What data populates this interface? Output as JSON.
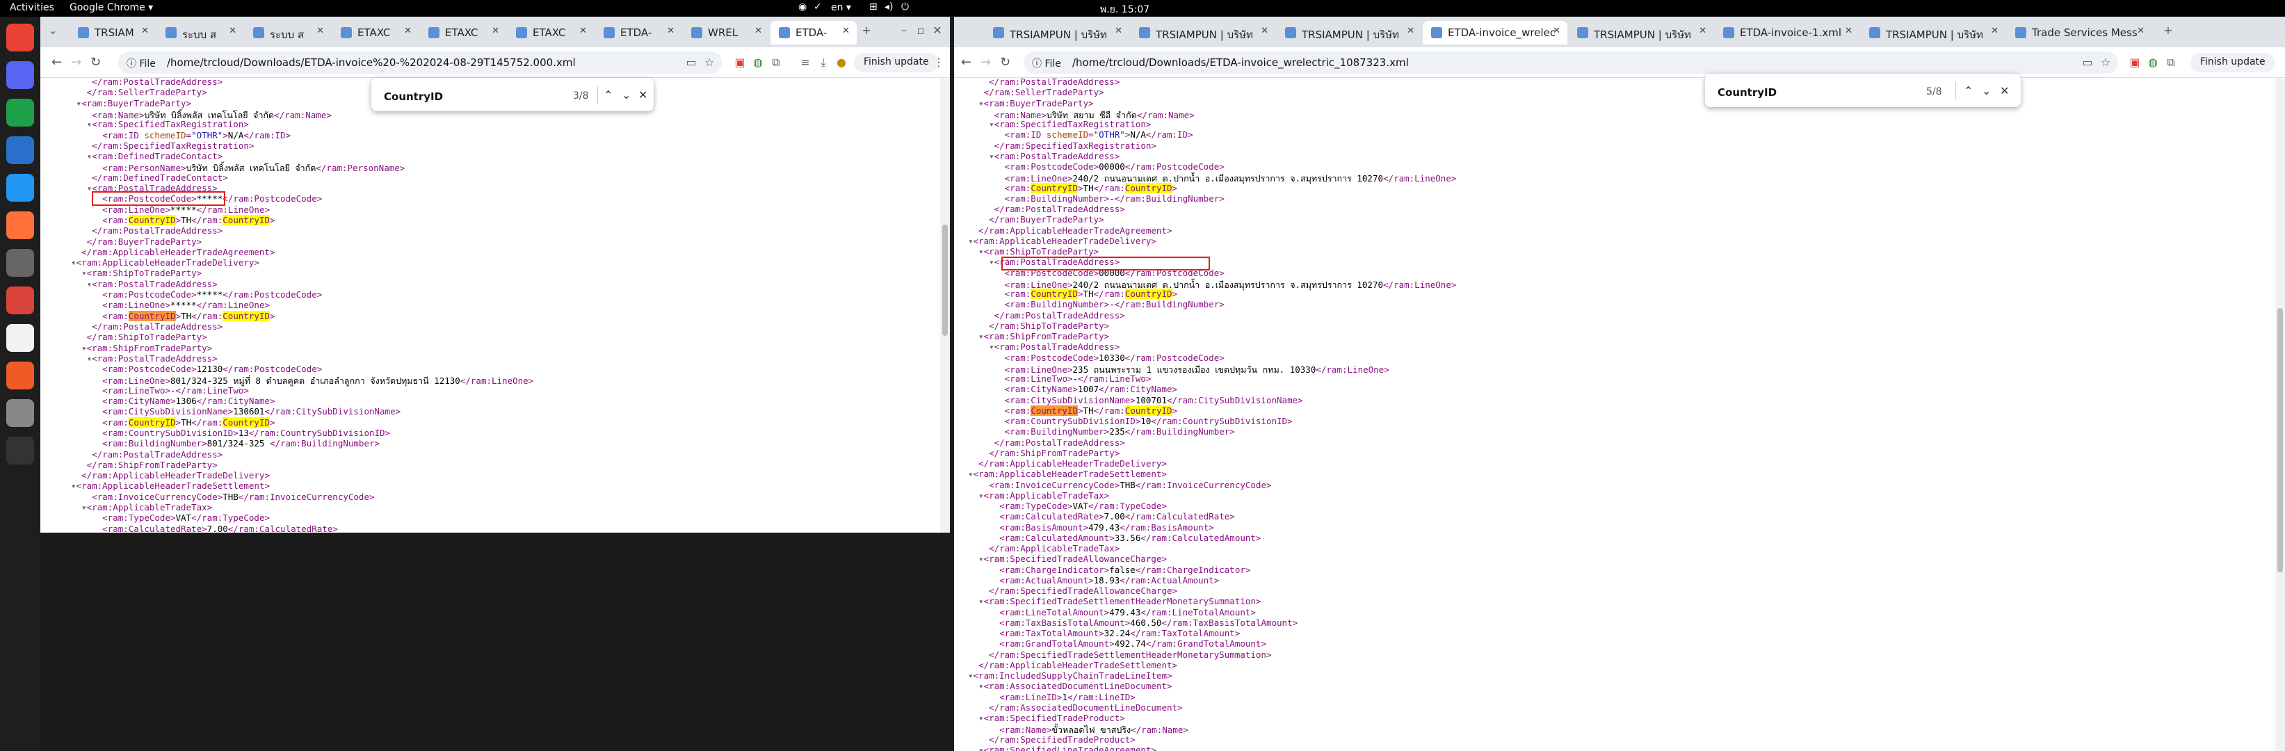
{
  "topbar": {
    "activities": "Activities",
    "app": "Google Chrome ▾",
    "clock": "พ.ย. 15:07",
    "lang": "en ▾"
  },
  "win1": {
    "tabs": [
      {
        "label": "TRSIAM"
      },
      {
        "label": "ระบบ ส"
      },
      {
        "label": "ระบบ ส"
      },
      {
        "label": "ETAXC"
      },
      {
        "label": "ETAXC"
      },
      {
        "label": "ETAXC"
      },
      {
        "label": "ETDA-"
      },
      {
        "label": "WREL"
      },
      {
        "label": "ETDA-"
      }
    ],
    "url": "/home/trcloud/Downloads/ETDA-invoice%20-%202024-08-29T145752.000.xml",
    "file_label": "File",
    "update_label": "Finish update",
    "find": {
      "query": "CountryID",
      "count": "3/8"
    },
    "lines": [
      "    </ram:PostalTradeAddress>",
      "   </ram:SellerTradeParty>",
      " ▾<ram:BuyerTradeParty>",
      "    <ram:Name>บริษัท บิลิ้งพลัส เทคโนโลยี จำกัด</ram:Name>",
      "   ▾<ram:SpecifiedTaxRegistration>",
      "      <ram:ID schemeID=\"OTHR\">N/A</ram:ID>",
      "    </ram:SpecifiedTaxRegistration>",
      "   ▾<ram:DefinedTradeContact>",
      "      <ram:PersonName>บริษัท บิลิ้งพลัส เทคโนโลยี จำกัด</ram:PersonName>",
      "    </ram:DefinedTradeContact>",
      "   ▾<ram:PostalTradeAddress>",
      "      <ram:PostcodeCode>*****</ram:PostcodeCode>",
      "      <ram:LineOne>*****</ram:LineOne>",
      "      <ram:CountryID>TH</ram:CountryID>",
      "    </ram:PostalTradeAddress>",
      "   </ram:BuyerTradeParty>",
      "  </ram:ApplicableHeaderTradeAgreement>",
      "▾<ram:ApplicableHeaderTradeDelivery>",
      "  ▾<ram:ShipToTradeParty>",
      "   ▾<ram:PostalTradeAddress>",
      "      <ram:PostcodeCode>*****</ram:PostcodeCode>",
      "      <ram:LineOne>*****</ram:LineOne>",
      "      <ram:CountryID>TH</ram:CountryID>",
      "    </ram:PostalTradeAddress>",
      "   </ram:ShipToTradeParty>",
      "  ▾<ram:ShipFromTradeParty>",
      "   ▾<ram:PostalTradeAddress>",
      "      <ram:PostcodeCode>12130</ram:PostcodeCode>",
      "      <ram:LineOne>801/324-325 หมู่ที่ 8 ตำบลคูคต อำเภอลำลูกกา จังหวัดปทุมธานี 12130</ram:LineOne>",
      "      <ram:LineTwo>-</ram:LineTwo>",
      "      <ram:CityName>1306</ram:CityName>",
      "      <ram:CitySubDivisionName>130601</ram:CitySubDivisionName>",
      "      <ram:CountryID>TH</ram:CountryID>",
      "      <ram:CountrySubDivisionID>13</ram:CountrySubDivisionID>",
      "      <ram:BuildingNumber>801/324-325 </ram:BuildingNumber>",
      "    </ram:PostalTradeAddress>",
      "   </ram:ShipFromTradeParty>",
      "  </ram:ApplicableHeaderTradeDelivery>",
      "▾<ram:ApplicableHeaderTradeSettlement>",
      "    <ram:InvoiceCurrencyCode>THB</ram:InvoiceCurrencyCode>",
      "  ▾<ram:ApplicableTradeTax>",
      "      <ram:TypeCode>VAT</ram:TypeCode>",
      "      <ram:CalculatedRate>7.00</ram:CalculatedRate>"
    ]
  },
  "win2": {
    "tabs": [
      {
        "label": "TRSIAMPUN | บริษัท"
      },
      {
        "label": "TRSIAMPUN | บริษัท"
      },
      {
        "label": "TRSIAMPUN | บริษัท"
      },
      {
        "label": "ETDA-invoice_wrelec"
      },
      {
        "label": "TRSIAMPUN | บริษัท"
      },
      {
        "label": "ETDA-invoice-1.xml"
      },
      {
        "label": "TRSIAMPUN | บริษัท"
      },
      {
        "label": "Trade Services Mess"
      }
    ],
    "url": "/home/trcloud/Downloads/ETDA-invoice_wrelectric_1087323.xml",
    "file_label": "File",
    "update_label": "Finish update",
    "find": {
      "query": "CountryID",
      "count": "5/8"
    },
    "lines": [
      "    </ram:PostalTradeAddress>",
      "   </ram:SellerTradeParty>",
      "  ▾<ram:BuyerTradeParty>",
      "     <ram:Name>บริษัท สยาม ซีอี จำกัด</ram:Name>",
      "    ▾<ram:SpecifiedTaxRegistration>",
      "       <ram:ID schemeID=\"OTHR\">N/A</ram:ID>",
      "     </ram:SpecifiedTaxRegistration>",
      "    ▾<ram:PostalTradeAddress>",
      "       <ram:PostcodeCode>00000</ram:PostcodeCode>",
      "       <ram:LineOne>240/2 ถนนอนามเตศ ต.ปากน้ำ อ.เมืองสมุทรปราการ จ.สมุทรปราการ 10270</ram:LineOne>",
      "       <ram:CountryID>TH</ram:CountryID>",
      "       <ram:BuildingNumber>-</ram:BuildingNumber>",
      "     </ram:PostalTradeAddress>",
      "    </ram:BuyerTradeParty>",
      "  </ram:ApplicableHeaderTradeAgreement>",
      "▾<ram:ApplicableHeaderTradeDelivery>",
      "  ▾<ram:ShipToTradeParty>",
      "    ▾<ram:PostalTradeAddress>",
      "       <ram:PostcodeCode>00000</ram:PostcodeCode>",
      "       <ram:LineOne>240/2 ถนนอนามเตศ ต.ปากน้ำ อ.เมืองสมุทรปราการ จ.สมุทรปราการ 10270</ram:LineOne>",
      "       <ram:CountryID>TH</ram:CountryID>",
      "       <ram:BuildingNumber>-</ram:BuildingNumber>",
      "     </ram:PostalTradeAddress>",
      "    </ram:ShipToTradeParty>",
      "  ▾<ram:ShipFromTradeParty>",
      "    ▾<ram:PostalTradeAddress>",
      "       <ram:PostcodeCode>10330</ram:PostcodeCode>",
      "       <ram:LineOne>235 ถนนพระราม 1 แขวงรองเมือง เขตปทุมวัน กทม. 10330</ram:LineOne>",
      "       <ram:LineTwo>-</ram:LineTwo>",
      "       <ram:CityName>1007</ram:CityName>",
      "       <ram:CitySubDivisionName>100701</ram:CitySubDivisionName>",
      "       <ram:CountryID>TH</ram:CountryID>",
      "       <ram:CountrySubDivisionID>10</ram:CountrySubDivisionID>",
      "       <ram:BuildingNumber>235</ram:BuildingNumber>",
      "     </ram:PostalTradeAddress>",
      "    </ram:ShipFromTradeParty>",
      "  </ram:ApplicableHeaderTradeDelivery>",
      "▾<ram:ApplicableHeaderTradeSettlement>",
      "    <ram:InvoiceCurrencyCode>THB</ram:InvoiceCurrencyCode>",
      "  ▾<ram:ApplicableTradeTax>",
      "      <ram:TypeCode>VAT</ram:TypeCode>",
      "      <ram:CalculatedRate>7.00</ram:CalculatedRate>",
      "      <ram:BasisAmount>479.43</ram:BasisAmount>",
      "      <ram:CalculatedAmount>33.56</ram:CalculatedAmount>",
      "    </ram:ApplicableTradeTax>",
      "  ▾<ram:SpecifiedTradeAllowanceCharge>",
      "      <ram:ChargeIndicator>false</ram:ChargeIndicator>",
      "      <ram:ActualAmount>18.93</ram:ActualAmount>",
      "    </ram:SpecifiedTradeAllowanceCharge>",
      "  ▾<ram:SpecifiedTradeSettlementHeaderMonetarySummation>",
      "      <ram:LineTotalAmount>479.43</ram:LineTotalAmount>",
      "      <ram:TaxBasisTotalAmount>460.50</ram:TaxBasisTotalAmount>",
      "      <ram:TaxTotalAmount>32.24</ram:TaxTotalAmount>",
      "      <ram:GrandTotalAmount>492.74</ram:GrandTotalAmount>",
      "    </ram:SpecifiedTradeSettlementHeaderMonetarySummation>",
      "  </ram:ApplicableHeaderTradeSettlement>",
      "▾<ram:IncludedSupplyChainTradeLineItem>",
      "  ▾<ram:AssociatedDocumentLineDocument>",
      "      <ram:LineID>1</ram:LineID>",
      "    </ram:AssociatedDocumentLineDocument>",
      "  ▾<ram:SpecifiedTradeProduct>",
      "      <ram:Name>ขั้วหลอดไฟ ขาสปริง</ram:Name>",
      "    </ram:SpecifiedTradeProduct>",
      "  ▾<ram:SpecifiedLineTradeAgreement>"
    ]
  },
  "dock_icons": [
    {
      "name": "chrome-icon",
      "color": "#e94235"
    },
    {
      "name": "discord-icon",
      "color": "#5865f2"
    },
    {
      "name": "libreoffice-calc-icon",
      "color": "#1e9f4a"
    },
    {
      "name": "libreoffice-writer-icon",
      "color": "#2a6fc9"
    },
    {
      "name": "vscode-icon",
      "color": "#2196f3"
    },
    {
      "name": "firefox-icon",
      "color": "#ff7139"
    },
    {
      "name": "calculator-icon",
      "color": "#666666"
    },
    {
      "name": "screenshot-icon",
      "color": "#d9453a"
    },
    {
      "name": "text-editor-icon",
      "color": "#f2f2f2"
    },
    {
      "name": "postman-icon",
      "color": "#ef5b25"
    },
    {
      "name": "printer-icon",
      "color": "#888888"
    },
    {
      "name": "apps-grid-icon",
      "color": "#333333"
    }
  ]
}
